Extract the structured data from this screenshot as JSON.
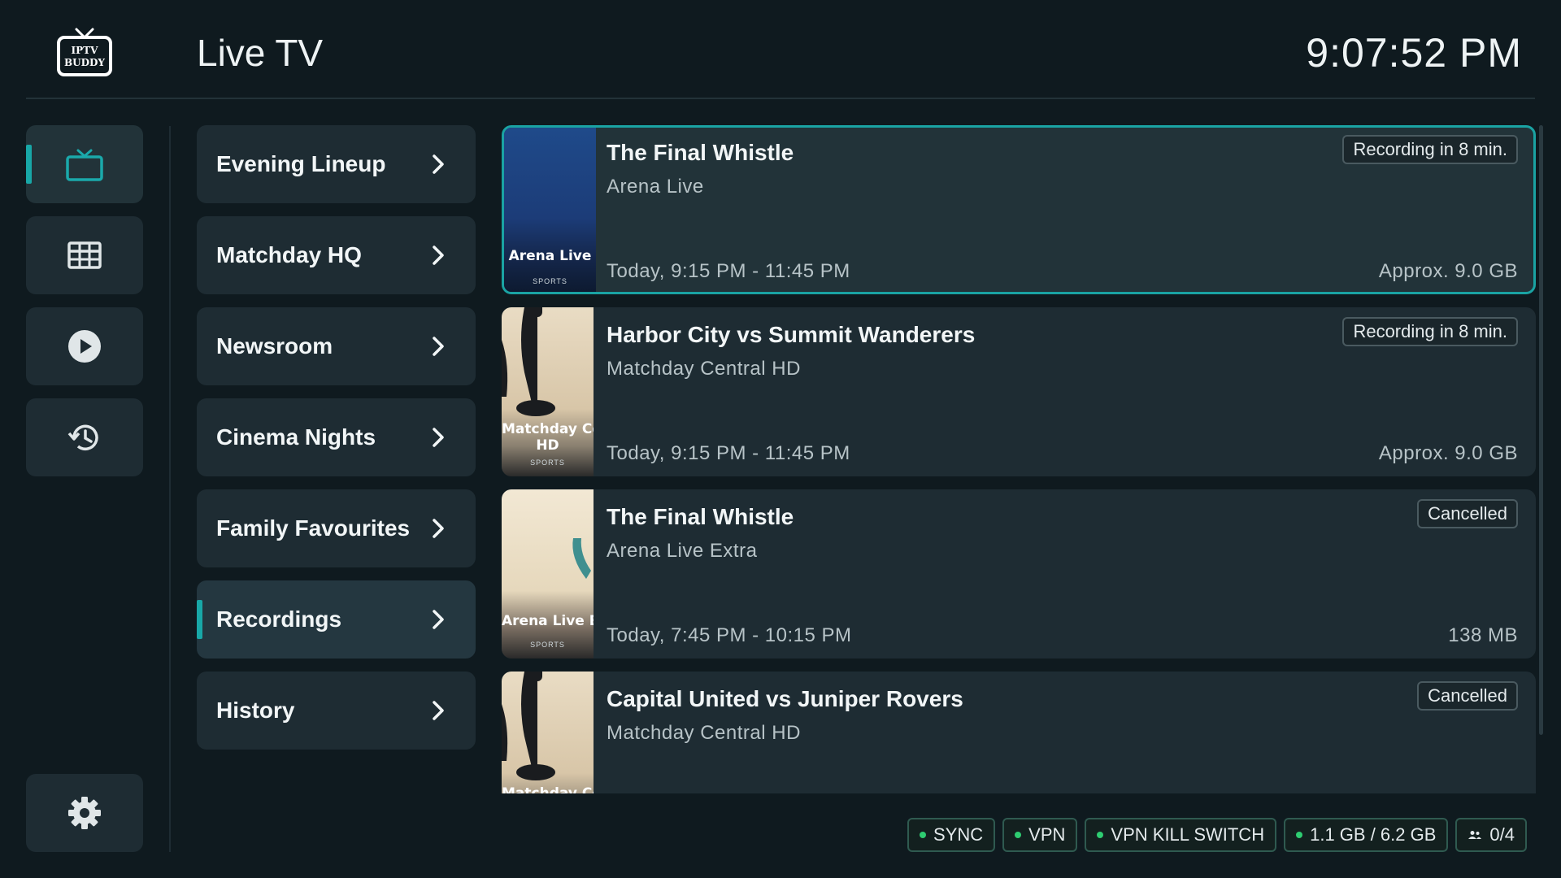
{
  "header": {
    "logo_text_line1": "IPTV",
    "logo_text_line2": "BUDDY",
    "title": "Live TV",
    "clock": "9:07:52 PM"
  },
  "rail": [
    {
      "icon": "tv-icon",
      "active": true
    },
    {
      "icon": "grid-icon",
      "active": false
    },
    {
      "icon": "play-icon",
      "active": false
    },
    {
      "icon": "history-icon",
      "active": false
    }
  ],
  "rail_settings_icon": "gear-icon",
  "categories": [
    {
      "label": "Evening Lineup"
    },
    {
      "label": "Matchday HQ"
    },
    {
      "label": "Newsroom"
    },
    {
      "label": "Cinema Nights"
    },
    {
      "label": "Family Favourites"
    },
    {
      "label": "Recordings",
      "active": true
    },
    {
      "label": "History"
    }
  ],
  "recordings": [
    {
      "title": "The Final Whistle",
      "channel": "Arena Live",
      "time": "Today, 9:15 PM - 11:45 PM",
      "size": "Approx. 9.0 GB",
      "status": "Recording in 8 min.",
      "thumb_label": "Arena Live",
      "thumb_label2": "",
      "thumb_sub": "SPORTS"
    },
    {
      "title": "Harbor City vs Summit Wanderers",
      "channel": "Matchday Central HD",
      "time": "Today, 9:15 PM - 11:45 PM",
      "size": "Approx. 9.0 GB",
      "status": "Recording in 8 min.",
      "thumb_label": "Matchday Central",
      "thumb_label2": "HD",
      "thumb_sub": "SPORTS"
    },
    {
      "title": "The Final Whistle",
      "channel": "Arena Live Extra",
      "time": "Today, 7:45 PM - 10:15 PM",
      "size": "138 MB",
      "status": "Cancelled",
      "thumb_label": "Arena Live Extra",
      "thumb_label2": "",
      "thumb_sub": "SPORTS"
    },
    {
      "title": "Capital United vs Juniper Rovers",
      "channel": "Matchday Central HD",
      "time": "",
      "size": "",
      "status": "Cancelled",
      "thumb_label": "Matchday Central",
      "thumb_label2": "",
      "thumb_sub": ""
    }
  ],
  "status_bar": {
    "sync": "SYNC",
    "vpn": "VPN",
    "kill_switch": "VPN KILL SWITCH",
    "storage": "1.1 GB / 6.2 GB",
    "users": "0/4"
  },
  "colors": {
    "background": "#0f1a1f",
    "surface": "#1e2c33",
    "accent": "#18a7a7",
    "status_ok": "#2ecc71"
  }
}
